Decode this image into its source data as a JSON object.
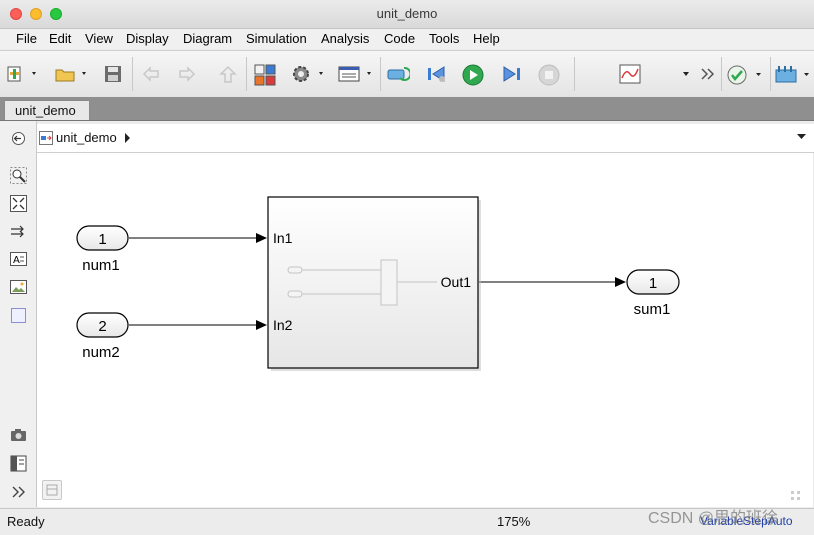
{
  "window": {
    "title": "unit_demo"
  },
  "menu": [
    "File",
    "Edit",
    "View",
    "Display",
    "Diagram",
    "Simulation",
    "Analysis",
    "Code",
    "Tools",
    "Help"
  ],
  "tab": {
    "label": "unit_demo"
  },
  "address": {
    "path": "unit_demo"
  },
  "model": {
    "inports": [
      {
        "number": "1",
        "name": "num1"
      },
      {
        "number": "2",
        "name": "num2"
      }
    ],
    "outports": [
      {
        "number": "1",
        "name": "sum1"
      }
    ],
    "subsystem": {
      "in_ports": [
        "In1",
        "In2"
      ],
      "out_ports": [
        "Out1"
      ]
    }
  },
  "status": {
    "left": "Ready",
    "zoom": "175%",
    "solver": "VariableStepAuto"
  },
  "watermark": {
    "text": "CSDN @思的班徐"
  },
  "colors": {
    "run_green": "#2fa84f",
    "accent_blue": "#3b7bd6",
    "tab_strip": "#8f8f8f"
  }
}
